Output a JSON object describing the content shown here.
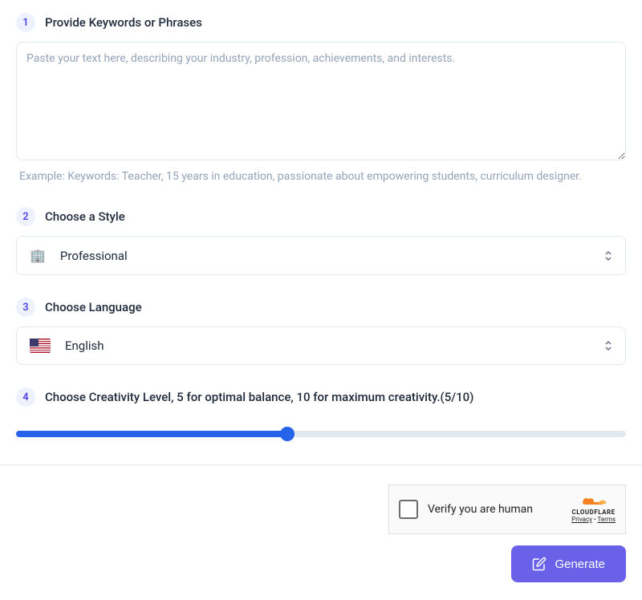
{
  "step1": {
    "number": "1",
    "title": "Provide Keywords or Phrases",
    "placeholder": "Paste your text here, describing your industry, profession, achievements, and interests.",
    "example": "Example:  Keywords: Teacher, 15 years in education, passionate about empowering students, curriculum designer."
  },
  "step2": {
    "number": "2",
    "title": "Choose a Style",
    "selected": "Professional",
    "icon": "🏢"
  },
  "step3": {
    "number": "3",
    "title": "Choose Language",
    "selected": "English"
  },
  "step4": {
    "number": "4",
    "title": "Choose Creativity Level, 5 for optimal balance, 10 for maximum creativity.(5/10)",
    "value": 5,
    "max": 10,
    "percent": 44.5
  },
  "captcha": {
    "text": "Verify you are human",
    "brand": "CLOUDFLARE",
    "privacy": "Privacy",
    "terms": "Terms"
  },
  "generate": {
    "label": "Generate"
  }
}
